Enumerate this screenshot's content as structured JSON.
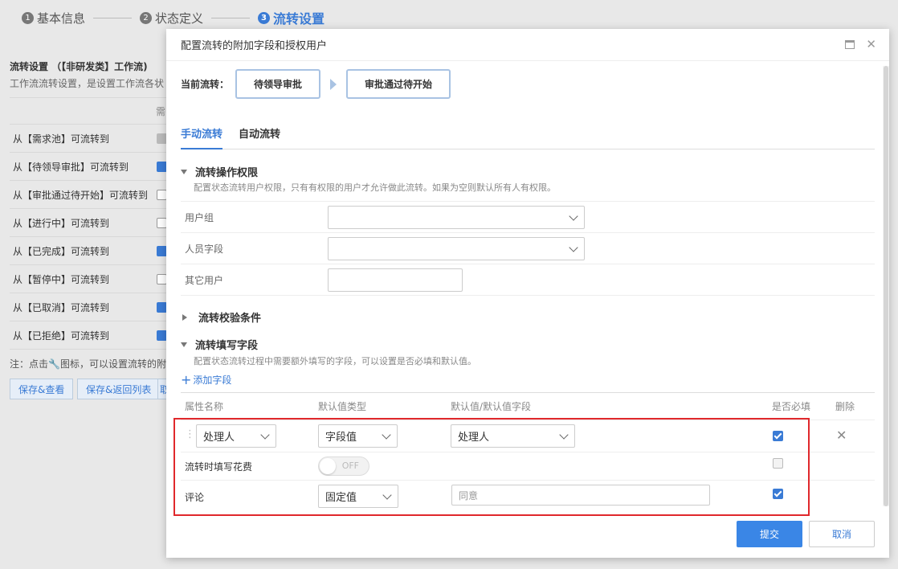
{
  "steps": [
    {
      "num": "1",
      "label": "基本信息"
    },
    {
      "num": "2",
      "label": "状态定义"
    },
    {
      "num": "3",
      "label": "流转设置"
    }
  ],
  "background": {
    "title": "流转设置 （【非研发类】工作流)",
    "desc": "工作流流转设置，是设置工作流各状",
    "col_header": "需",
    "rows": [
      {
        "label": "从【需求池】可流转到",
        "state": "dis"
      },
      {
        "label": "从【待领导审批】可流转到",
        "state": "on"
      },
      {
        "label": "从【审批通过待开始】可流转到",
        "state": "off"
      },
      {
        "label": "从【进行中】可流转到",
        "state": "off"
      },
      {
        "label": "从【已完成】可流转到",
        "state": "on"
      },
      {
        "label": "从【暂停中】可流转到",
        "state": "off"
      },
      {
        "label": "从【已取消】可流转到",
        "state": "on"
      },
      {
        "label": "从【已拒绝】可流转到",
        "state": "on"
      }
    ],
    "note_prefix": "注：点击",
    "note_suffix": "图标，可以设置流转的附",
    "btn_save_view": "保存&查看",
    "btn_save_back": "保存&返回列表",
    "btn_more": "取"
  },
  "modal": {
    "title": "配置流转的附加字段和授权用户",
    "current_label": "当前流转：",
    "from_state": "待领导审批",
    "to_state": "审批通过待开始",
    "tabs": [
      "手动流转",
      "自动流转"
    ],
    "sec1": {
      "title": "流转操作权限",
      "desc": "配置状态流转用户权限，只有有权限的用户才允许做此流转。如果为空则默认所有人有权限。",
      "user_group": "用户组",
      "person_field": "人员字段",
      "other_users": "其它用户"
    },
    "sec2": {
      "title": "流转校验条件"
    },
    "sec3": {
      "title": "流转填写字段",
      "desc": "配置状态流转过程中需要额外填写的字段，可以设置是否必填和默认值。",
      "add_field": "添加字段"
    },
    "table": {
      "headers": [
        "属性名称",
        "默认值类型",
        "默认值/默认值字段",
        "是否必填",
        "删除"
      ],
      "row1": {
        "name": "处理人",
        "type": "字段值",
        "default": "处理人",
        "required": true
      },
      "row2": {
        "name": "流转时填写花费",
        "toggle": "OFF",
        "required": false
      },
      "row3": {
        "name": "评论",
        "type": "固定值",
        "default_placeholder": "同意",
        "required": true
      }
    },
    "submit": "提交",
    "cancel": "取消"
  },
  "colors": {
    "accent": "#3a7bd5",
    "highlight_border": "#e0282c"
  }
}
